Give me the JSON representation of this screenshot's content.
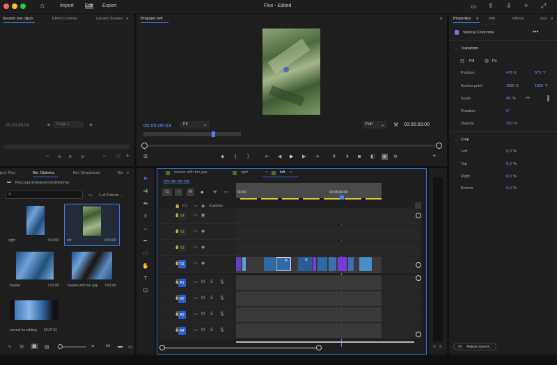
{
  "app": {
    "title": "Flux - Edited",
    "menu": [
      "Import",
      "Edit",
      "Export"
    ]
  },
  "source": {
    "tabs": [
      "Source: (no clips)",
      "Effect Controls",
      "Lumetri Scopes"
    ],
    "timecode": "00;00;00;00",
    "page": "Page 1"
  },
  "program": {
    "tab": "Program: left",
    "timecode": "00:05:05:03",
    "fit": "Fit",
    "full": "Full",
    "duration": "00:06:59:00"
  },
  "project": {
    "tabs": [
      "ject: Flux",
      "Bin: Diploma",
      "Bin: Sequences",
      "Bin"
    ],
    "path": "Flux.prproj\\Sequences\\Diploma",
    "count": "1 of 5 items ...",
    "items": [
      {
        "name": "right",
        "dur": "7:02:00"
      },
      {
        "name": "left",
        "dur": "6:59:00"
      },
      {
        "name": "master",
        "dur": "7:02:00"
      },
      {
        "name": "master with the gap",
        "dur": "7:02:00"
      },
      {
        "name": "normal for editing",
        "dur": "50:07:11"
      }
    ]
  },
  "timeline": {
    "tabs": [
      "master with the gap",
      "right",
      "left"
    ],
    "timecode": "00:05:05:03",
    "ruler": [
      ":00:00",
      "00:05:00:00"
    ],
    "tracks": {
      "cl": "CL",
      "subtitle": "Subtitle",
      "video": [
        "V4",
        "V3",
        "V2",
        "V1"
      ],
      "audio": [
        "A1",
        "A2",
        "A3",
        "A4"
      ],
      "mute": "M",
      "solo": "S",
      "fx": "fx"
    }
  },
  "properties": {
    "tabs": [
      "Properties",
      "Info",
      "Effects",
      "Gra"
    ],
    "clip": "Vertical Color.mov",
    "transform": "Transform",
    "fill": "Fill",
    "fit": "Fit",
    "position_label": "Position",
    "position_x": "478",
    "position_y": "573",
    "anchor_label": "Anchor point",
    "anchor_x": "1080",
    "anchor_y": "1920",
    "scale_label": "Scale",
    "scale_value": "45",
    "rotation_label": "Rotation",
    "rotation_value": "0",
    "opacity_label": "Opacity",
    "opacity_value": "100",
    "crop": "Crop",
    "left": "Left",
    "left_v": "0,0",
    "top": "Top",
    "top_v": "0,0",
    "right": "Right",
    "right_v": "0,0",
    "bottom": "Bottom",
    "bottom_v": "0,0",
    "x_unit": "X",
    "y_unit": "Y",
    "percent": "%",
    "deg": "°",
    "adjust": "Adjust speed..."
  },
  "meter": {
    "labels": [
      "S",
      "S"
    ]
  }
}
